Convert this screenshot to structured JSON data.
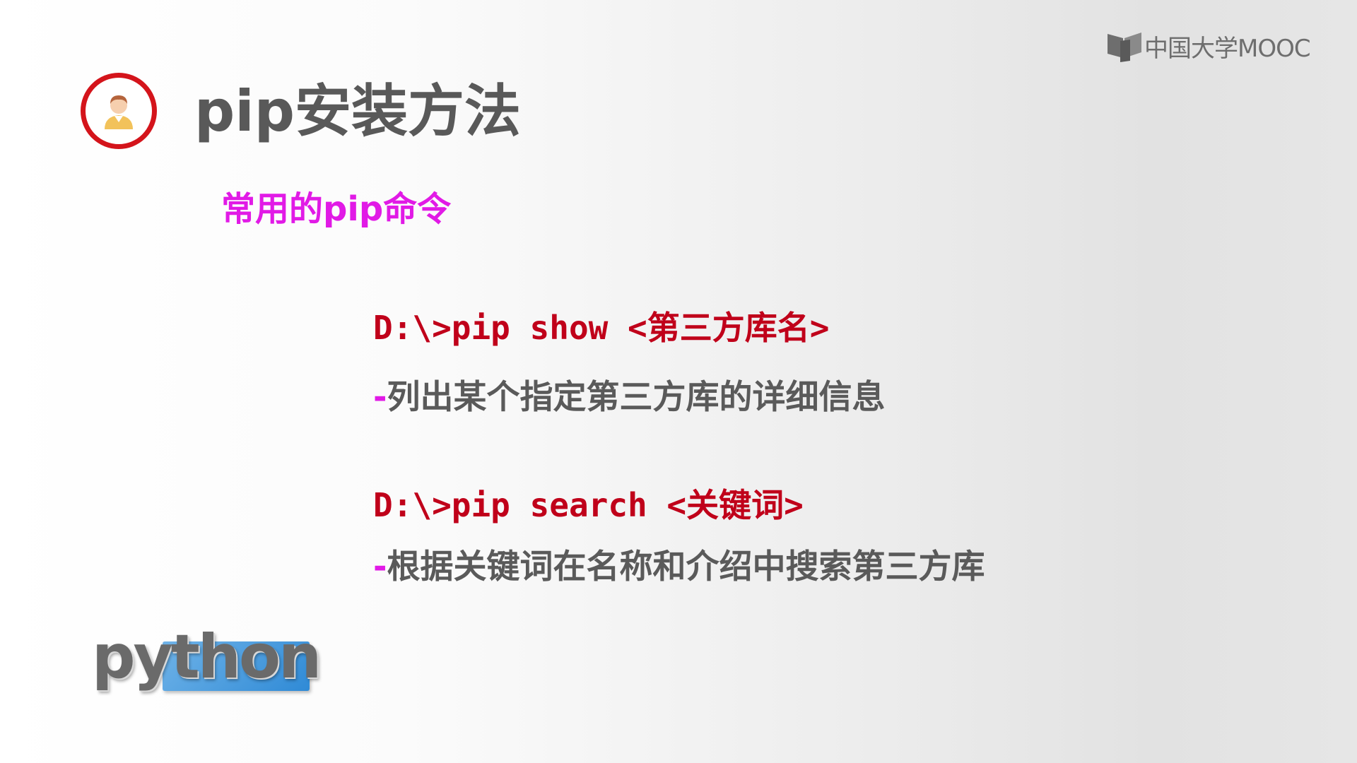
{
  "watermark": {
    "logo_text": "中国大学MOOC"
  },
  "slide": {
    "title": "pip安装方法",
    "subtitle": "常用的pip命令",
    "commands": [
      {
        "command": "D:\\>pip show <第三方库名>",
        "dash": "-",
        "description": "列出某个指定第三方库的详细信息"
      },
      {
        "command": "D:\\>pip search <关键词>",
        "dash": "-",
        "description": "根据关键词在名称和介绍中搜索第三方库"
      }
    ]
  },
  "python_logo": {
    "text": "python"
  },
  "icons": {
    "avatar": "person-avatar-icon",
    "mooc": "open-book-icon"
  },
  "colors": {
    "title": "#595959",
    "subtitle": "#e11ae6",
    "command": "#c0001a",
    "description": "#5a5a5a",
    "avatar_ring": "#d4141b",
    "python_box": "#2f8ad6"
  }
}
